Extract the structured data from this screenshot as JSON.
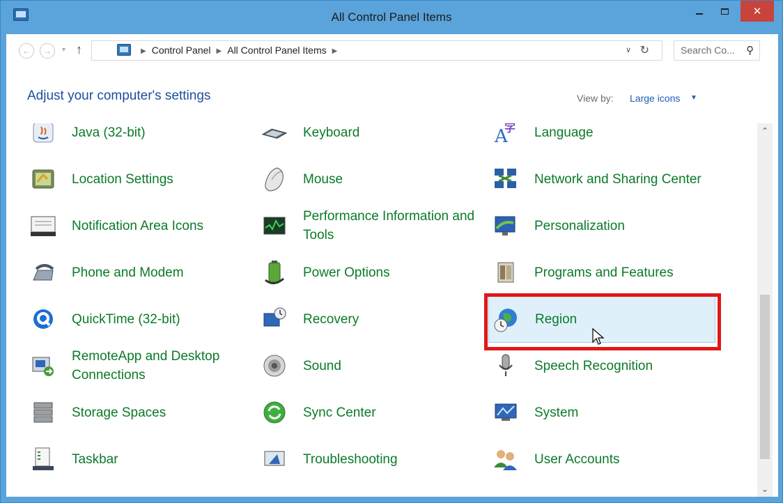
{
  "window": {
    "title": "All Control Panel Items",
    "close_glyph": "✕"
  },
  "address": {
    "crumbs": [
      "Control Panel",
      "All Control Panel Items"
    ],
    "search_placeholder": "Search Co..."
  },
  "header": {
    "heading": "Adjust your computer's settings",
    "view_by_label": "View by:",
    "view_by_value": "Large icons"
  },
  "items": {
    "java": "Java (32-bit)",
    "keyboard": "Keyboard",
    "language": "Language",
    "location": "Location Settings",
    "mouse": "Mouse",
    "network": "Network and Sharing Center",
    "notification": "Notification Area Icons",
    "performance": "Performance Information and Tools",
    "personalization": "Personalization",
    "phone": "Phone and Modem",
    "power": "Power Options",
    "programs": "Programs and Features",
    "quicktime": "QuickTime (32-bit)",
    "recovery": "Recovery",
    "region": "Region",
    "remoteapp": "RemoteApp and Desktop Connections",
    "sound": "Sound",
    "speech": "Speech Recognition",
    "storage": "Storage Spaces",
    "sync": "Sync Center",
    "system": "System",
    "taskbar": "Taskbar",
    "troubleshooting": "Troubleshooting",
    "users": "User Accounts"
  },
  "selected_item": "Region",
  "colors": {
    "link_green": "#0b7a28",
    "heading_blue": "#1e4e9b",
    "highlight_red": "#e01818",
    "titlebar": "#5aa3db",
    "close_button": "#c7433b"
  }
}
